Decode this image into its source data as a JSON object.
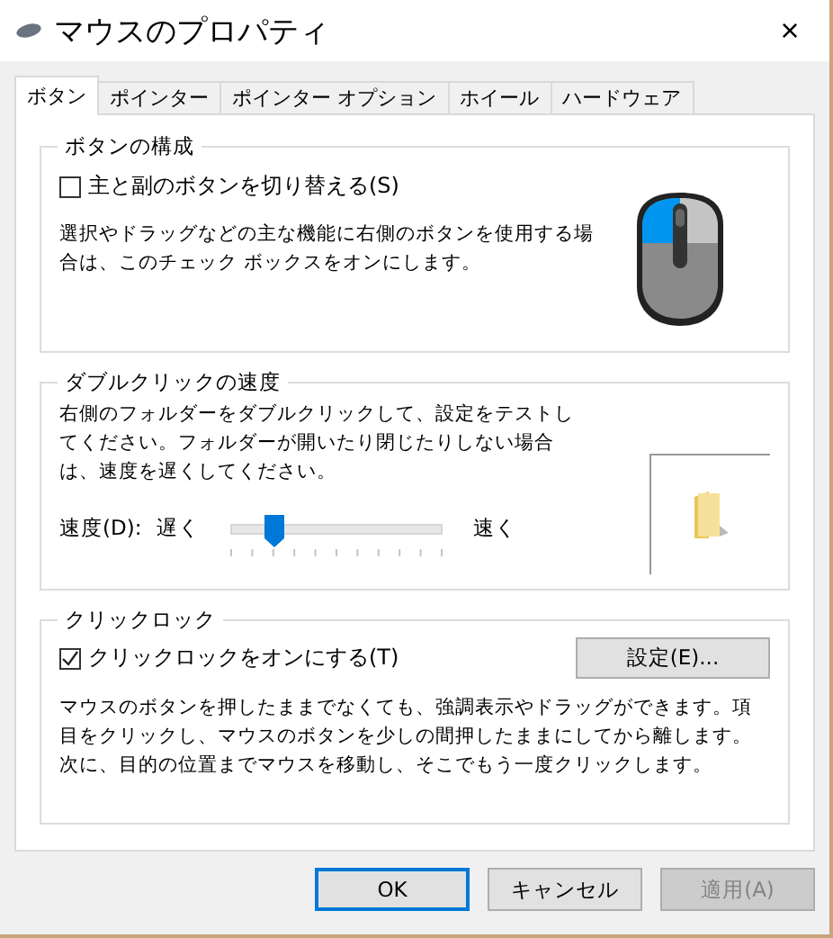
{
  "window": {
    "title": "マウスのプロパティ",
    "close": "×"
  },
  "tabs": [
    {
      "label": "ボタン",
      "selected": true
    },
    {
      "label": "ポインター",
      "selected": false
    },
    {
      "label": "ポインター オプション",
      "selected": false
    },
    {
      "label": "ホイール",
      "selected": false
    },
    {
      "label": "ハードウェア",
      "selected": false
    }
  ],
  "button_config": {
    "title": "ボタンの構成",
    "checkbox": {
      "label": "主と副のボタンを切り替える(S)",
      "checked": false
    },
    "description": "選択やドラッグなどの主な機能に右側のボタンを使用する場合は、このチェック ボックスをオンにします。"
  },
  "double_click": {
    "title": "ダブルクリックの速度",
    "description": "右側のフォルダーをダブルクリックして、設定をテストしてください。フォルダーが開いたり閉じたりしない場合は、速度を遅くしてください。",
    "speed_label": "速度(D):",
    "slow": "遅く",
    "fast": "速く",
    "level": 0.2
  },
  "click_lock": {
    "title": "クリックロック",
    "checkbox": {
      "label": "クリックロックをオンにする(T)",
      "checked": true
    },
    "settings_button": "設定(E)...",
    "description": "マウスのボタンを押したままでなくても、強調表示やドラッグができます。項目をクリックし、マウスのボタンを少しの間押したままにしてから離します。次に、目的の位置までマウスを移動し、そこでもう一度クリックします。"
  },
  "buttons": [
    {
      "label": "OK",
      "kind": "default",
      "disabled": false
    },
    {
      "label": "キャンセル",
      "kind": "normal",
      "disabled": false
    },
    {
      "label": "適用(A)",
      "kind": "normal",
      "disabled": true
    }
  ]
}
